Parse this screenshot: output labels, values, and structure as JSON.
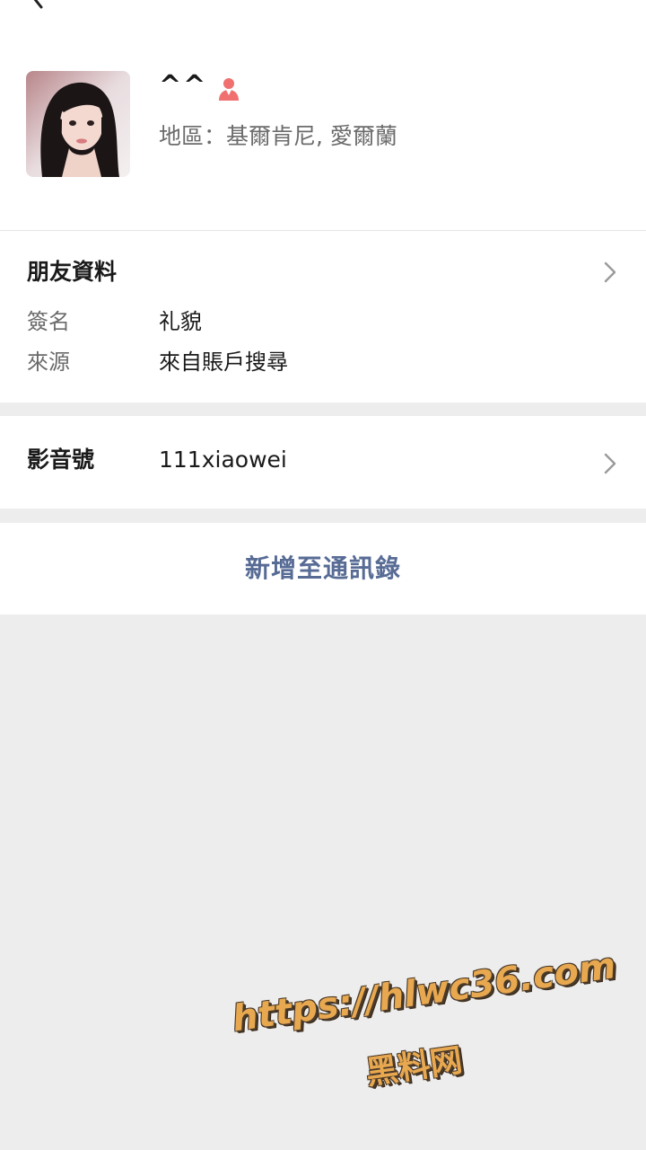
{
  "profile": {
    "name": "^^",
    "region_label": "地區：",
    "region_value": "基爾肯尼, 愛爾蘭"
  },
  "friend_info": {
    "title": "朋友資料",
    "signature_label": "簽名",
    "signature_value": "礼貌",
    "source_label": "來源",
    "source_value": "來自賬戶搜尋"
  },
  "video_id": {
    "label": "影音號",
    "value": "111xiaowei"
  },
  "actions": {
    "add_contact": "新增至通訊錄"
  },
  "watermark": {
    "url": "https://hlwc36.com",
    "brand": "黑料网"
  },
  "icons": {
    "back": "chevron-left-icon",
    "gender": "female-icon",
    "chevron": "chevron-right-icon"
  },
  "colors": {
    "link": "#576b95",
    "gender_icon": "#f07070",
    "background": "#ededed"
  }
}
